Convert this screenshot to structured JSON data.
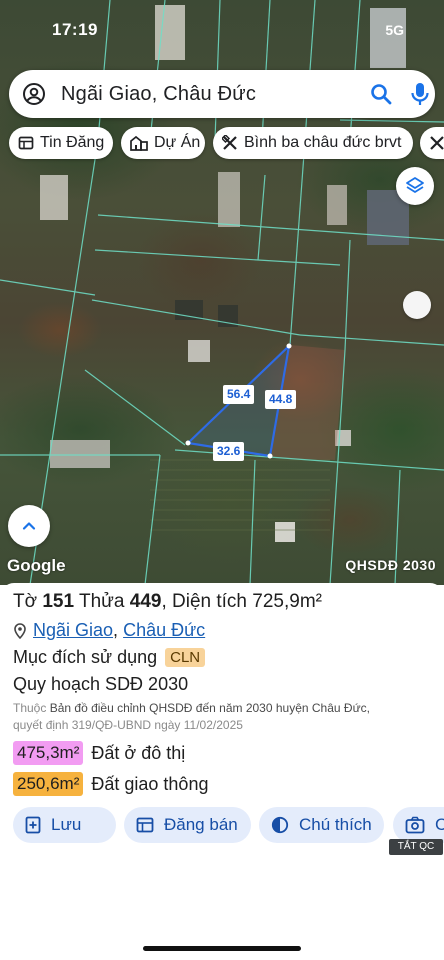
{
  "status_bar": {
    "time": "17:19",
    "network": "5G"
  },
  "search": {
    "query": "Ngãi Giao, Châu Đức"
  },
  "chips": [
    {
      "label": "Tin Đăng",
      "icon": "listing-icon"
    },
    {
      "label": "Dự Án",
      "icon": "project-icon"
    },
    {
      "label": "Bình ba châu đức brvt",
      "icon": "planning-icon"
    }
  ],
  "map": {
    "attribution": "Google",
    "layer_label": "QHSDĐ 2030",
    "dimensions": {
      "side_a": "56.4",
      "side_b": "44.8",
      "side_c": "32.6"
    }
  },
  "parcel": {
    "sheet_label": "Tờ",
    "sheet_no": "151",
    "parcel_label": "Thửa",
    "parcel_no": "449",
    "area_label": ", Diện tích",
    "area_value": "725,9m²",
    "location_ward": "Ngãi Giao",
    "location_sep": ",",
    "location_district": "Châu Đức",
    "purpose_label": "Mục đích sử dụng",
    "purpose_code": "CLN",
    "plan_title": "Quy hoạch SDĐ 2030",
    "plan_desc_prefix": "Thuộc",
    "plan_desc_main": "Bản đồ điều chỉnh QHSDĐ đến năm 2030 huyện Châu Đức,",
    "plan_desc_decision": "quyết định 319/QĐ-UBND ngày 11/02/2025",
    "zones": [
      {
        "area": "475,3m²",
        "label": "Đất ở đô thị",
        "color": "#f29cf2"
      },
      {
        "area": "250,6m²",
        "label": "Đất giao thông",
        "color": "#f6b23e"
      }
    ]
  },
  "actions": [
    {
      "label": "Lưu",
      "icon": "save-icon"
    },
    {
      "label": "Đăng bán",
      "icon": "post-listing-icon"
    },
    {
      "label": "Chú thích",
      "icon": "legend-icon"
    },
    {
      "label": "C",
      "icon": "camera-icon"
    }
  ],
  "ad_tag": "TẮT QC",
  "colors": {
    "accent_blue": "#1a73e8",
    "button_bg": "#e4ecfb",
    "cln_badge": "#f8d39a"
  }
}
